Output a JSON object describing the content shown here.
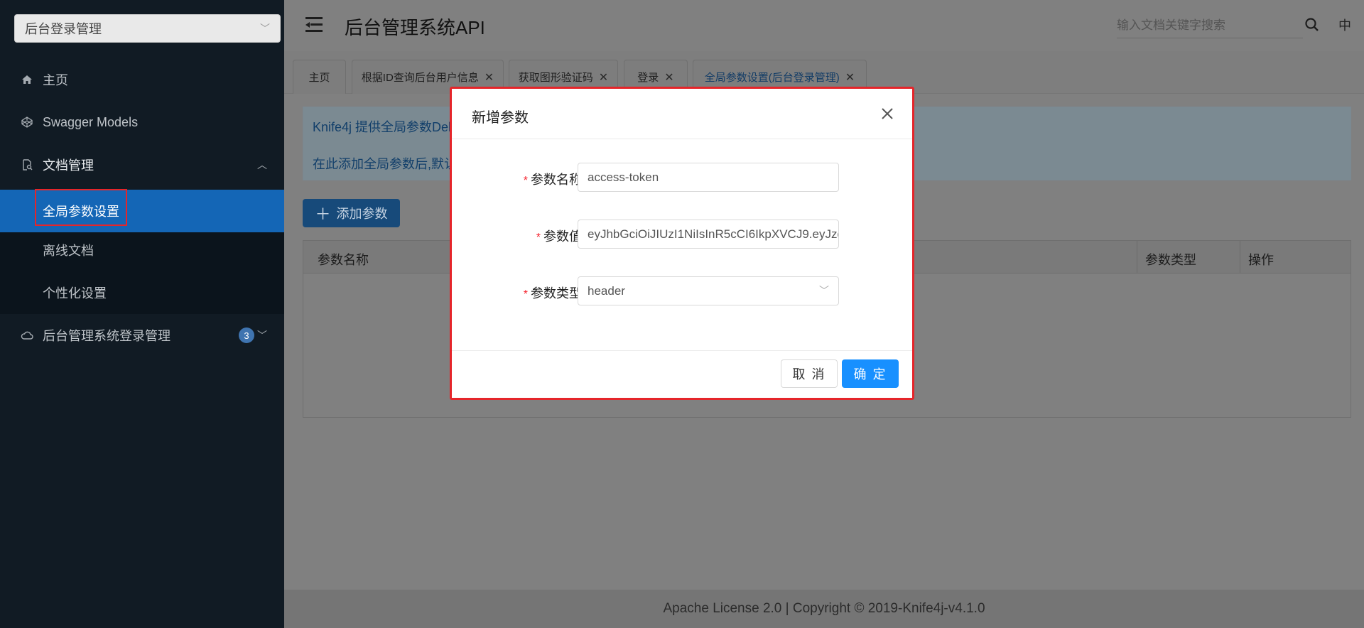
{
  "sidebar": {
    "group_select": "后台登录管理",
    "items": [
      {
        "label": "主页"
      },
      {
        "label": "Swagger Models"
      },
      {
        "label": "文档管理"
      },
      {
        "label": "全局参数设置"
      },
      {
        "label": "离线文档"
      },
      {
        "label": "个性化设置"
      },
      {
        "label": "后台管理系统登录管理",
        "badge": "3"
      }
    ]
  },
  "header": {
    "title": "后台管理系统API",
    "search_placeholder": "输入文档关键字搜索",
    "lang": "中"
  },
  "tabs": [
    {
      "label": "主页"
    },
    {
      "label": "根据ID查询后台用户信息"
    },
    {
      "label": "获取图形验证码"
    },
    {
      "label": "登录"
    },
    {
      "label": "全局参数设置(后台登录管理)"
    }
  ],
  "main": {
    "alert_line1": "Knife4j 提供全局参数Deb",
    "alert_line2": "在此添加全局参数后,默认",
    "add_button": "添加参数",
    "table_headers": [
      "参数名称",
      "参数类型",
      "操作"
    ]
  },
  "footer": {
    "text": "Apache License 2.0 | Copyright © 2019-Knife4j-v4.1.0"
  },
  "modal": {
    "title": "新增参数",
    "fields": [
      {
        "label": "参数名称:",
        "value": "access-token"
      },
      {
        "label": "参数值:",
        "value": "eyJhbGciOiJIUzI1NiIsInR5cCI6IkpXVCJ9.eyJzc"
      },
      {
        "label": "参数类型:",
        "value": "header"
      }
    ],
    "cancel": "取 消",
    "ok": "确 定"
  },
  "colors": {
    "sidebar_bg": "#111b24",
    "active_item": "#1466b6",
    "primary": "#1890ff",
    "highlight_border": "#e5252a"
  }
}
